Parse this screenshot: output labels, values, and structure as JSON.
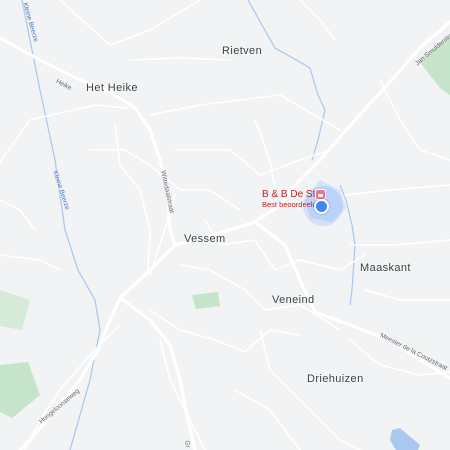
{
  "map": {
    "places": {
      "rietven": "Rietven",
      "het_heike": "Het Heike",
      "vessem": "Vessem",
      "maaskant": "Maaskant",
      "veneind": "Veneind",
      "driehuizen": "Driehuizen"
    },
    "streets": {
      "heike": "Heike",
      "wittedaalstraat": "Wittedaalstraat",
      "jan_smulderstraat": "Jan Smulderstraat",
      "meester_coutzstraat": "Meester de la Coutzstraat",
      "hoogeloonseweg": "Hoogeloonseweg",
      "gr": "Gr"
    },
    "waterways": {
      "kleine_beerze_top": "Kleine Beerze",
      "kleine_beerze": "Kleine Beerze"
    },
    "poi": {
      "name": "B & B De Stijl",
      "subtitle": "Best beoordeeld",
      "icon": "hotel-bed-icon"
    },
    "my_location": {
      "icon": "current-location-icon"
    },
    "colors": {
      "background": "#f1f3f4",
      "road": "#ffffff",
      "water": "#a9c7ef",
      "park": "#c5e4c9",
      "poi_text": "#c5221f",
      "location_dot": "#4285f4"
    }
  }
}
